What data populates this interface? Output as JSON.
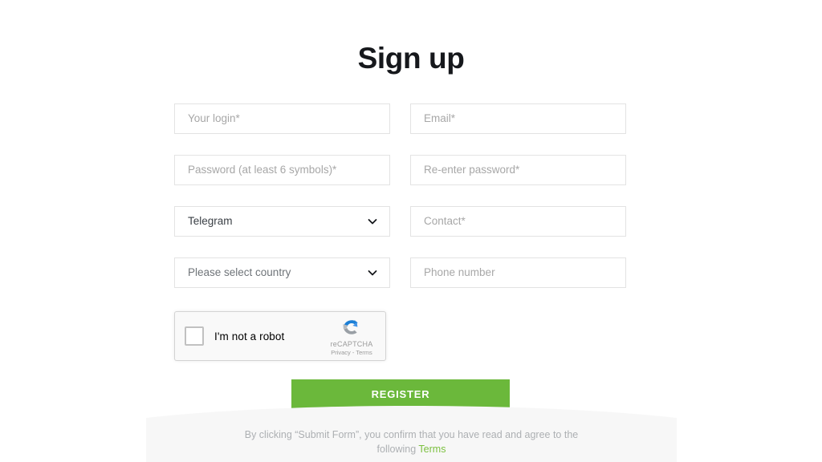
{
  "page": {
    "title": "Sign up"
  },
  "form": {
    "fields": [
      {
        "name": "login",
        "type": "input",
        "placeholder": "Your login*"
      },
      {
        "name": "email",
        "type": "input",
        "placeholder": "Email*"
      },
      {
        "name": "password",
        "type": "input",
        "placeholder": "Password (at least 6 symbols)*"
      },
      {
        "name": "confirm-password",
        "type": "input",
        "placeholder": "Re-enter password*"
      },
      {
        "name": "messenger",
        "type": "select",
        "value": "Telegram",
        "icon": "chevron-down-icon"
      },
      {
        "name": "contact",
        "type": "input",
        "placeholder": "Contact*"
      },
      {
        "name": "country",
        "type": "select",
        "value": "Please select country",
        "icon": "chevron-down-icon"
      },
      {
        "name": "phone",
        "type": "input",
        "placeholder": "Phone number"
      }
    ],
    "login_placeholder": "Your login*",
    "email_placeholder": "Email*",
    "password_placeholder": "Password (at least 6 symbols)*",
    "confirm_password_placeholder": "Re-enter password*",
    "messenger_value": "Telegram",
    "contact_placeholder": "Contact*",
    "country_value": "Please select country",
    "phone_placeholder": "Phone number"
  },
  "recaptcha": {
    "label": "I'm not a robot",
    "brand": "reCAPTCHA",
    "legal": "Privacy - Terms",
    "checked": false
  },
  "submit": {
    "label": "REGISTER",
    "color": "#6bb83b"
  },
  "footer": {
    "text_line1": "By clicking “Submit Form”, you confirm that you have read and agree to the",
    "text_line2_prefix": "following ",
    "terms_label": "Terms",
    "terms_color": "#7cc040",
    "panel_color": "#f7f7f7"
  }
}
